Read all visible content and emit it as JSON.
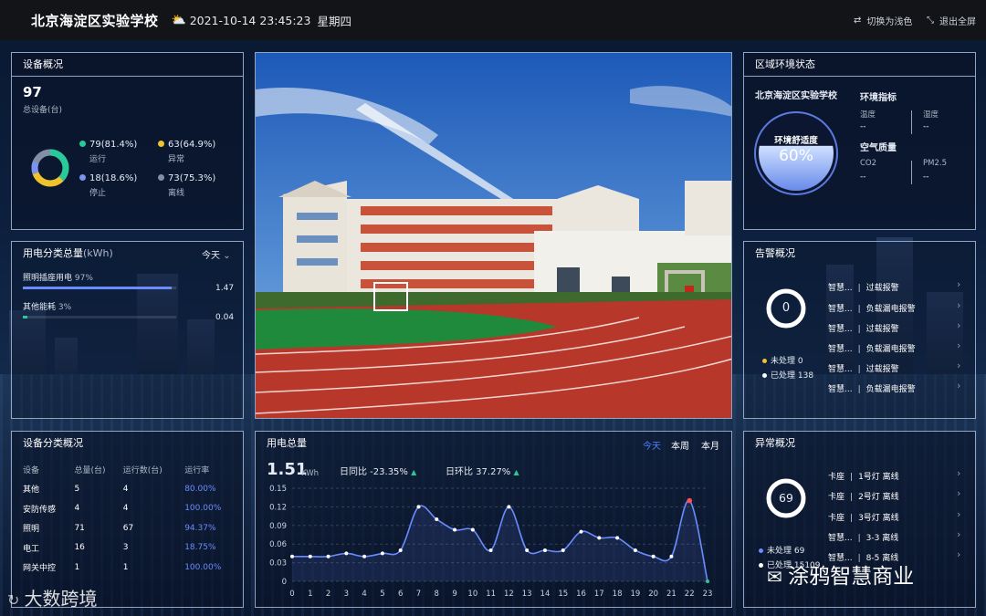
{
  "header": {
    "title": "北京海淀区实验学校",
    "weather_icon": "sun-cloud-icon",
    "datetime": "2021-10-14 23:45:23",
    "weekday": "星期四",
    "switch_theme_label": "切换为浅色",
    "exit_fullscreen_label": "退出全屏"
  },
  "equipment_overview": {
    "title": "设备概况",
    "total": "97",
    "total_label": "总设备(台)",
    "stats": [
      {
        "value": "79(81.4%)",
        "label": "运行",
        "color": "#29c99a"
      },
      {
        "value": "63(64.9%)",
        "label": "异常",
        "color": "#f0c22c"
      },
      {
        "value": "18(18.6%)",
        "label": "停止",
        "color": "#7c93f2"
      },
      {
        "value": "73(75.3%)",
        "label": "离线",
        "color": "#8290a6"
      }
    ]
  },
  "power_category": {
    "title": "用电分类总量",
    "unit": "(kWh)",
    "period": "今天",
    "items": [
      {
        "name": "照明插座用电",
        "pct": "97%",
        "value": "1.47",
        "fill": 0.97
      },
      {
        "name": "其他能耗",
        "pct": "3%",
        "value": "0.04",
        "fill": 0.03
      }
    ]
  },
  "equipment_category": {
    "title": "设备分类概况",
    "columns": [
      "设备",
      "总量(台)",
      "运行数(台)",
      "运行率"
    ],
    "rows": [
      [
        "其他",
        "5",
        "4",
        "80.00%"
      ],
      [
        "安防传感",
        "4",
        "4",
        "100.00%"
      ],
      [
        "照明",
        "71",
        "67",
        "94.37%"
      ],
      [
        "电工",
        "16",
        "3",
        "18.75%"
      ],
      [
        "网关中控",
        "1",
        "1",
        "100.00%"
      ]
    ]
  },
  "environment": {
    "title": "区域环境状态",
    "school": "北京海淀区实验学校",
    "comfort_label": "环境舒适度",
    "comfort_value": "60%",
    "comfort_level": 0.6,
    "env_index_label": "环境指标",
    "temp_label": "温度",
    "temp_value": "--",
    "humidity_label": "湿度",
    "humidity_value": "--",
    "air_label": "空气质量",
    "co2_label": "CO2",
    "co2_value": "--",
    "pm_label": "PM2.5",
    "pm_value": "--"
  },
  "alarm": {
    "title": "告警概况",
    "count": "0",
    "unhandled": "未处理 0",
    "handled": "已处理 138",
    "unhandled_color": "#f0c22c",
    "handled_color": "#ffffff",
    "items": [
      {
        "device": "智慧...",
        "type": "过载报警"
      },
      {
        "device": "智慧...",
        "type": "负载漏电报警"
      },
      {
        "device": "智慧...",
        "type": "过载报警"
      },
      {
        "device": "智慧...",
        "type": "负载漏电报警"
      },
      {
        "device": "智慧...",
        "type": "过载报警"
      },
      {
        "device": "智慧...",
        "type": "负载漏电报警"
      }
    ]
  },
  "power_total": {
    "title": "用电总量",
    "value": "1.51",
    "unit": "KWh",
    "yoy_label": "日同比 -23.35%",
    "mom_label": "日环比 37.27%",
    "tabs": [
      "今天",
      "本周",
      "本月"
    ],
    "active_tab": "今天"
  },
  "anomaly": {
    "title": "异常概况",
    "count": "69",
    "unhandled": "未处理 69",
    "handled": "已处理 15109",
    "unhandled_color": "#6a8cff",
    "items": [
      {
        "device": "卡座",
        "text": "1号灯 离线"
      },
      {
        "device": "卡座",
        "text": "2号灯 离线"
      },
      {
        "device": "卡座",
        "text": "3号灯 离线"
      },
      {
        "device": "智慧...",
        "text": "3-3 离线"
      },
      {
        "device": "智慧...",
        "text": "8-5 离线"
      }
    ]
  },
  "watermarks": {
    "left": "大数跨境",
    "right": "涂鸦智慧商业"
  },
  "chart_data": {
    "type": "line",
    "x": [
      0,
      1,
      2,
      3,
      4,
      5,
      6,
      7,
      8,
      9,
      10,
      11,
      12,
      13,
      14,
      15,
      16,
      17,
      18,
      19,
      20,
      21,
      22,
      23
    ],
    "series": [
      {
        "values": [
          0.04,
          0.04,
          0.04,
          0.045,
          0.04,
          0.045,
          0.05,
          0.12,
          0.1,
          0.083,
          0.083,
          0.05,
          0.12,
          0.05,
          0.05,
          0.05,
          0.08,
          0.07,
          0.07,
          0.05,
          0.04,
          0.04,
          0.13,
          0.0
        ],
        "color": "#6a8cff"
      }
    ],
    "yticks": [
      "0",
      "0.03",
      "0.06",
      "0.09",
      "0.12",
      "0.15"
    ],
    "ylim": [
      0,
      0.15
    ],
    "grid": true,
    "title": "",
    "xlabel": "",
    "ylabel": ""
  }
}
